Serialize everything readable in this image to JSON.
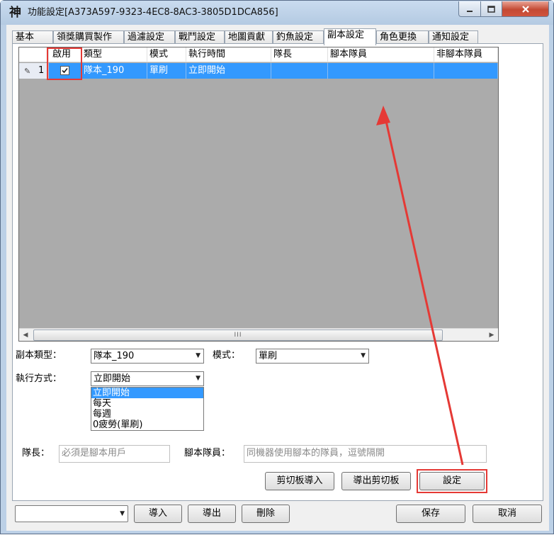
{
  "window": {
    "title": "功能設定[A373A597-9323-4EC8-8AC3-3805D1DCA856]",
    "app_icon_glyph": "神"
  },
  "tabs": [
    {
      "label": "基本"
    },
    {
      "label": "領獎購買製作"
    },
    {
      "label": "過濾設定"
    },
    {
      "label": "戰鬥設定"
    },
    {
      "label": "地圖貢獻"
    },
    {
      "label": "釣魚設定"
    },
    {
      "label": "副本設定",
      "active": true
    },
    {
      "label": "角色更換"
    },
    {
      "label": "通知設定"
    }
  ],
  "grid": {
    "columns": [
      "啟用",
      "類型",
      "模式",
      "執行時間",
      "隊長",
      "腳本隊員",
      "非腳本隊員"
    ],
    "rows": [
      {
        "num": "1",
        "enabled": true,
        "type": "隊本_190",
        "mode": "單刷",
        "time": "立即開始",
        "leader": "",
        "members": "",
        "non_members": ""
      }
    ],
    "scroll_mark": "III"
  },
  "form": {
    "dungeon_type_label": "副本類型：",
    "dungeon_type_value": "隊本_190",
    "mode_label": "模式：",
    "mode_value": "單刷",
    "exec_label": "執行方式：",
    "exec_value": "立即開始",
    "exec_options": [
      "立即開始",
      "每天",
      "每週",
      "0疲勞(單刷)"
    ],
    "exec_selected_index": 0,
    "leader_label": "隊長：",
    "leader_placeholder": "必須是腳本用戶",
    "members_label": "腳本隊員：",
    "members_placeholder": "同機器使用腳本的隊員，逗號隔開",
    "import_clipboard": "剪切板導入",
    "export_clipboard": "導出剪切板",
    "set": "設定"
  },
  "footer": {
    "profile_value": "",
    "import": "導入",
    "export": "導出",
    "delete": "刪除",
    "save": "保存",
    "cancel": "取消"
  },
  "colors": {
    "selection": "#3399ff",
    "annotation": "#e53935",
    "grid_bg": "#ababab"
  }
}
